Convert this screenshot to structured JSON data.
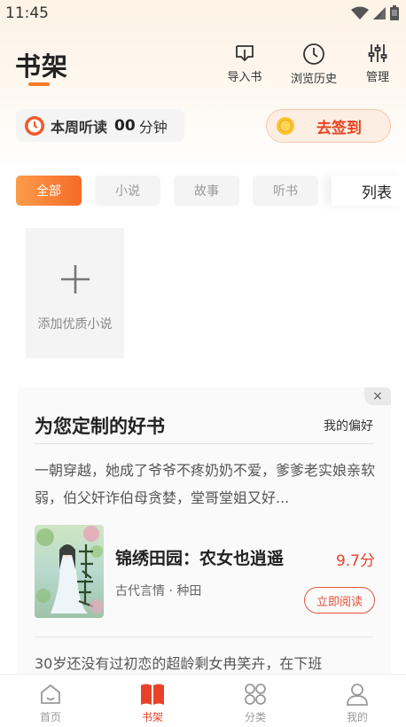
{
  "status_bar": {
    "time": "11:45"
  },
  "header": {
    "title": "书架",
    "actions": [
      {
        "label": "导入书",
        "icon": "import-icon"
      },
      {
        "label": "浏览历史",
        "icon": "history-clock-icon"
      },
      {
        "label": "管理",
        "icon": "sliders-icon"
      }
    ]
  },
  "listen_stats": {
    "label": "本周听读",
    "value": "00",
    "unit": "分钟"
  },
  "signin": {
    "label": "去签到"
  },
  "tabs": [
    {
      "label": "全部",
      "active": true
    },
    {
      "label": "小说",
      "active": false
    },
    {
      "label": "故事",
      "active": false
    },
    {
      "label": "听书",
      "active": false
    }
  ],
  "view_toggle": {
    "label": "列表"
  },
  "add_book": {
    "label": "添加优质小说"
  },
  "recommend": {
    "title": "为您定制的好书",
    "preference_link": "我的偏好",
    "close": "×",
    "description": "一朝穿越，她成了爷爷不疼奶奶不爱，爹爹老实娘亲软弱，伯父奸诈伯母贪婪，堂哥堂姐又好...",
    "book": {
      "name": "锦绣田园：农女也逍遥",
      "score": "9.7分",
      "meta": "古代言情 · 种田",
      "read_button": "立即阅读"
    },
    "description2": "30岁还没有过初恋的超龄剩女冉笑卉，在下班"
  },
  "bottom_nav": [
    {
      "label": "首页",
      "icon": "home-icon",
      "active": false
    },
    {
      "label": "书架",
      "icon": "bookshelf-icon",
      "active": true
    },
    {
      "label": "分类",
      "icon": "category-icon",
      "active": false
    },
    {
      "label": "我的",
      "icon": "profile-icon",
      "active": false
    }
  ],
  "colors": {
    "accent": "#f56b27",
    "price_red": "#e84327",
    "active_nav": "#e8432a"
  }
}
